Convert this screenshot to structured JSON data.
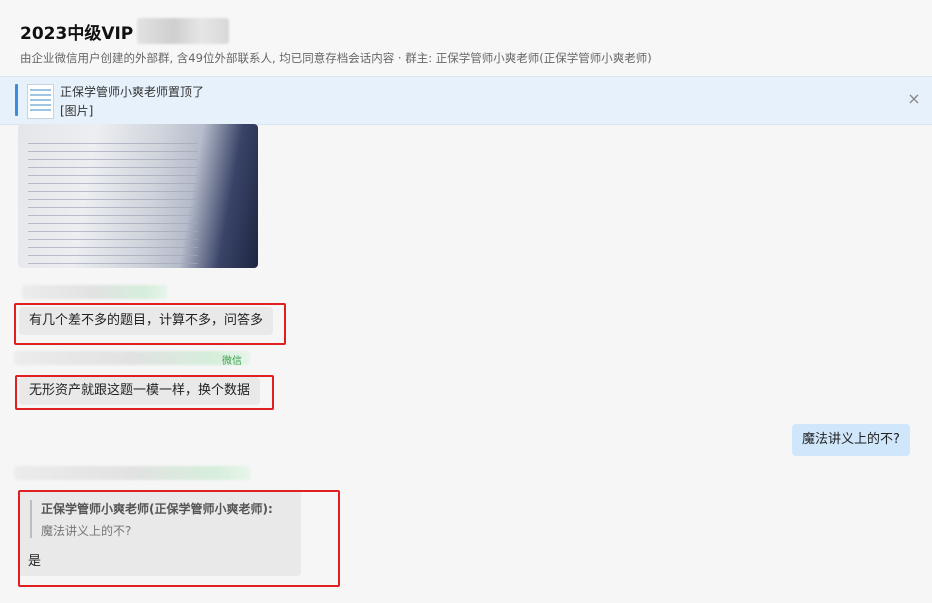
{
  "header": {
    "title": "2023中级VIP",
    "subtitle": "由企业微信用户创建的外部群, 含49位外部联系人, 均已同意存档会话内容  · 群主: 正保学管师小爽老师(正保学管师小爽老师)"
  },
  "pinned": {
    "line1": "正保学管师小爽老师置顶了",
    "line2": "[图片]",
    "close": "×"
  },
  "messages": {
    "m1": "有几个差不多的题目，计算不多，问答多",
    "m2_tag": "微信",
    "m2": "无形资产就跟这题一模一样，换个数据",
    "m3": "魔法讲义上的不?",
    "m4_quote_name": "正保学管师小爽老师(正保学管师小爽老师):",
    "m4_quote_text": "魔法讲义上的不?",
    "m4_reply": "是"
  },
  "colors": {
    "highlight_box": "#e02020",
    "pinned_bg": "#e6f1fb",
    "my_bubble": "#cfe6fb"
  }
}
